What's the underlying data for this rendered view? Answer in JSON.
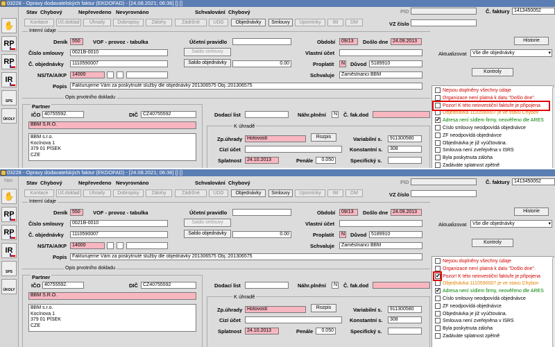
{
  "title": "03228 - Opravy dodavatelských faktur (EKDOFAD) - [24.08.2021; 06:36] [] []",
  "nav_label": "Nav",
  "leftbar": [
    "RP",
    "RP",
    "IR"
  ],
  "leftbar_small": [
    "SPS",
    "ÚKOLY"
  ],
  "status": {
    "stav_label": "Stav",
    "stav_value": "Chybový",
    "nepreveden": "Nepřevedeno",
    "nevyrovnano": "Nevyrovnáno",
    "schvalovani_label": "Schvalování",
    "schvalovani_value": "Chybový"
  },
  "toolbar": [
    "Kontace",
    "Úč.doklad",
    "Úhrady",
    "Dobropisy",
    "Zálohy",
    "Zádržné",
    "UDD",
    "Objednávky",
    "Smlouvy",
    "Upomínky",
    "IM",
    "DM"
  ],
  "pid_label": "PID",
  "cfaktury_label": "Č. faktury",
  "cfaktury_value": "1413450052",
  "vz_label": "VZ číslo",
  "interni": "Interní údaje",
  "denik_label": "Deník",
  "denik_value": "550",
  "denik_text": "VOF - provoz - tabulka",
  "ucetni_label": "Účetní pravidlo",
  "obdobi_label": "Období",
  "obdobi_value": "09/13",
  "doslo_label": "Došlo dne",
  "doslo_value": "24.09.2013",
  "historie": "Historie",
  "smlouvy_label": "Číslo smlouvy",
  "smlouvy_value": "0021B-0010",
  "saldo_smlouvy": "Saldo smlouvy",
  "vlastni_label": "Vlastní účet",
  "aktualizovat_label": "Aktualizovat",
  "aktualizovat_value": "Vše dle objednávky",
  "objednavky_label": "Č. objednávky",
  "objednavky_value": "1110590007",
  "saldo_objednavky": "Saldo objednávky",
  "saldo_value": "0.00",
  "proplatit_label": "Proplatit",
  "proplatit_value": "N",
  "duvod_label": "Důvod",
  "duvod_value": "5189910",
  "kontroly": "Kontroly",
  "ns_label": "NS/TA/A/KP",
  "ns_value": "14000",
  "schvaluje_label": "Schvaluje",
  "schvaluje_value": "Zaměstnanci BBM",
  "popis_label": "Popis",
  "popis_value": "Fakturujeme Vám za poskytnuté služby dle objednávky 201306575 Obj.:201306575",
  "opis": "Opis prvotního dokladu",
  "partner": "Partner",
  "ico_label": "IČO",
  "ico_value": "40755592.",
  "dic_label": "DIČ",
  "dic_value": "CZ40755592",
  "partner_name": "BBM S.R.O.",
  "addr": [
    "BBM s.r.o.",
    "Kocínova 1",
    "379 01 PÍSEK",
    "CZE"
  ],
  "dodaci_label": "Dodací list",
  "nahr_label": "Náhr.plnění",
  "nahr_value": "N",
  "cfakdod_label": "Č. fak.dod",
  "kuhrade": "K úhradě",
  "zpuhrady_label": "Zp.úhrady",
  "zpuhrady_value": "Hotovostí",
  "rozpis": "Rozpis",
  "variabilni_label": "Variabilní s.",
  "variabilni_value": "911300580",
  "cizi_label": "Cizí účet",
  "konstantni_label": "Konstantní s.",
  "konstantni_value": "308",
  "splatnost_label": "Splatnost",
  "splatnost_value": "24.10.2013",
  "penale_label": "Penále",
  "penale_value": "0.050",
  "specificky_label": "Specifický s.",
  "checks": [
    {
      "text": "Nejsou doplněny všechny údaje",
      "color": "red",
      "on1": false,
      "on2": false
    },
    {
      "text": "Organizace není platná k datu \"Došlo dne\".",
      "color": "red",
      "on1": false,
      "on2": false
    },
    {
      "text": "Pozor! K této neinvestiční faktuře je připojena",
      "color": "red",
      "on1": false,
      "on2": true
    },
    {
      "text": "Objednávka 1110590007 je ve stavu Chybov",
      "color": "orange",
      "on1": false,
      "on2": false
    },
    {
      "text": "Adresa není sídlem firmy, neověřeno dle ARES",
      "color": "green",
      "on1": true,
      "on2": true
    },
    {
      "text": "Číslo smlouvy neodpovídá objednávce",
      "color": "black",
      "on1": false,
      "on2": false
    },
    {
      "text": "ZF neodpovídá objednávce",
      "color": "black",
      "on1": false,
      "on2": false
    },
    {
      "text": "Objednávka je již vyúčtována.",
      "color": "black",
      "on1": false,
      "on2": false
    },
    {
      "text": "Smlouva není zveřejněna v ISRS",
      "color": "black",
      "on1": false,
      "on2": false
    },
    {
      "text": "Byla poskytnuta záloha",
      "color": "black",
      "on1": false,
      "on2": false
    },
    {
      "text": "Zadáváte splatnost zpětně",
      "color": "black",
      "on1": false,
      "on2": false
    }
  ]
}
